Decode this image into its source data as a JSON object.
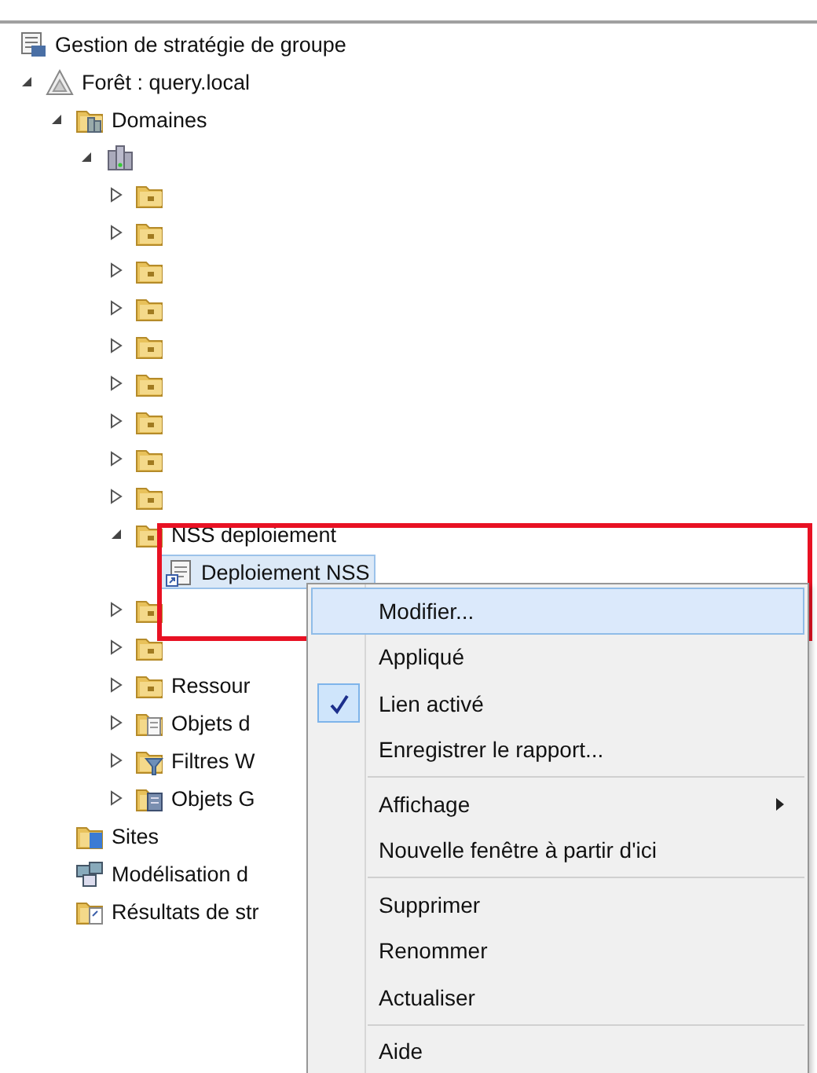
{
  "tree": [
    {
      "label": "Gestion de stratégie de groupe",
      "kind": "console",
      "selected": false,
      "children": [
        {
          "label": "Forêt : query.local",
          "kind": "forest",
          "expanded": true,
          "selected": false,
          "children": [
            {
              "label": "Domaines",
              "kind": "domains",
              "expanded": true,
              "selected": false,
              "children": [
                {
                  "kind": "domain",
                  "expanded": true,
                  "selected": false,
                  "children": [
                    {
                      "kind": "ou",
                      "expanded": false,
                      "selected": false
                    },
                    {
                      "kind": "ou",
                      "expanded": false,
                      "selected": false
                    },
                    {
                      "kind": "ou",
                      "expanded": false,
                      "selected": false
                    },
                    {
                      "kind": "ou",
                      "expanded": false,
                      "selected": false
                    },
                    {
                      "kind": "ou",
                      "expanded": false,
                      "selected": false
                    },
                    {
                      "kind": "ou",
                      "expanded": false,
                      "selected": false
                    },
                    {
                      "kind": "ou",
                      "expanded": false,
                      "selected": false
                    },
                    {
                      "kind": "ou",
                      "expanded": false,
                      "selected": false
                    },
                    {
                      "kind": "ou",
                      "expanded": false,
                      "selected": false
                    },
                    {
                      "label": "NSS deploiement",
                      "kind": "ou",
                      "expanded": true,
                      "selected": false,
                      "children": [
                        {
                          "label": "Deploiement NSS",
                          "kind": "gpo-link",
                          "selected": true
                        }
                      ]
                    },
                    {
                      "kind": "ou",
                      "expanded": false,
                      "selected": false
                    },
                    {
                      "kind": "ou",
                      "expanded": false,
                      "selected": false
                    },
                    {
                      "label": "Ressour",
                      "kind": "ou",
                      "expanded": false,
                      "selected": false
                    },
                    {
                      "label": "Objets d",
                      "kind": "gpo-folder",
                      "expanded": false,
                      "selected": false
                    },
                    {
                      "label": "Filtres W",
                      "kind": "wmi-filter",
                      "expanded": false,
                      "selected": false
                    },
                    {
                      "label": "Objets G",
                      "kind": "starter-gpo",
                      "expanded": false,
                      "selected": false
                    }
                  ]
                }
              ]
            },
            {
              "label": "Sites",
              "kind": "sites",
              "selected": false
            },
            {
              "label": "Modélisation d",
              "kind": "modeling",
              "selected": false
            },
            {
              "label": "Résultats de str",
              "kind": "results",
              "selected": false
            }
          ]
        }
      ]
    }
  ],
  "context_menu": [
    {
      "kind": "item",
      "label": "Modifier...",
      "selected": true,
      "checked": false,
      "submenu": false
    },
    {
      "kind": "item",
      "label": "Appliqué",
      "selected": false,
      "checked": false,
      "submenu": false
    },
    {
      "kind": "item",
      "label": "Lien activé",
      "selected": false,
      "checked": true,
      "submenu": false
    },
    {
      "kind": "item",
      "label": "Enregistrer le rapport...",
      "selected": false,
      "checked": false,
      "submenu": false
    },
    {
      "kind": "separator"
    },
    {
      "kind": "item",
      "label": "Affichage",
      "selected": false,
      "checked": false,
      "submenu": true
    },
    {
      "kind": "item",
      "label": "Nouvelle fenêtre à partir d'ici",
      "selected": false,
      "checked": false,
      "submenu": false
    },
    {
      "kind": "separator"
    },
    {
      "kind": "item",
      "label": "Supprimer",
      "selected": false,
      "checked": false,
      "submenu": false
    },
    {
      "kind": "item",
      "label": "Renommer",
      "selected": false,
      "checked": false,
      "submenu": false
    },
    {
      "kind": "item",
      "label": "Actualiser",
      "selected": false,
      "checked": false,
      "submenu": false
    },
    {
      "kind": "separator"
    },
    {
      "kind": "item",
      "label": "Aide",
      "selected": false,
      "checked": false,
      "submenu": false
    }
  ]
}
